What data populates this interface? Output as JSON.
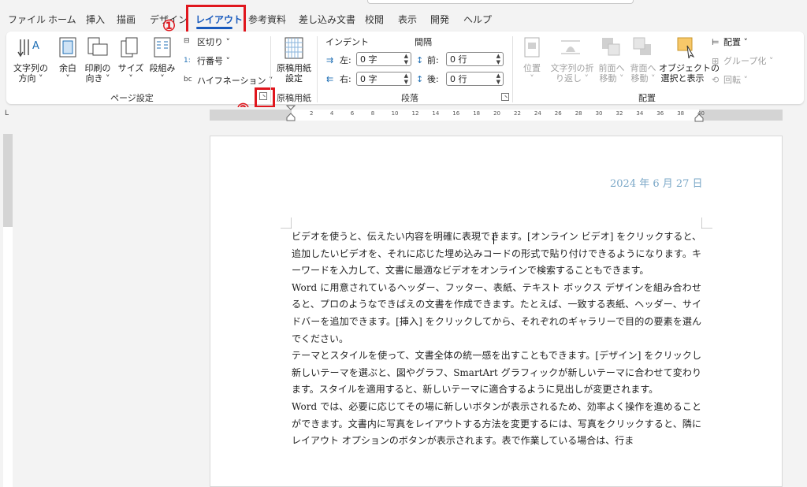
{
  "tabs": [
    "ファイル",
    "ホーム",
    "挿入",
    "描画",
    "デザイン",
    "レイアウト",
    "参考資料",
    "差し込み文書",
    "校閲",
    "表示",
    "開発",
    "ヘルプ"
  ],
  "active_tab": "レイアウト",
  "annotations": {
    "one": "①",
    "two": "②"
  },
  "page_setup": {
    "text_direction": [
      "文字列の",
      "方向 ˅"
    ],
    "margins": [
      "余白",
      "˅"
    ],
    "orientation": [
      "印刷の",
      "向き ˅"
    ],
    "size": [
      "サイズ",
      "˅"
    ],
    "columns": [
      "段組み",
      "˅"
    ],
    "breaks": "区切り ˅",
    "line_numbers": "行番号 ˅",
    "hyphenation": "ハイフネーション ˅",
    "group_label": "ページ設定"
  },
  "genko": {
    "button": [
      "原稿用紙",
      "設定"
    ],
    "group_label": "原稿用紙"
  },
  "paragraph": {
    "indent_header": "インデント",
    "spacing_header": "間隔",
    "left_label": "左:",
    "right_label": "右:",
    "before_label": "前:",
    "after_label": "後:",
    "left_value": "0 字",
    "right_value": "0 字",
    "before_value": "0 行",
    "after_value": "0 行",
    "group_label": "段落"
  },
  "arrange": {
    "position": [
      "位置",
      "˅"
    ],
    "wrap": [
      "文字列の折",
      "り返し ˅"
    ],
    "forward": [
      "前面へ",
      "移動 ˅"
    ],
    "backward": [
      "背面へ",
      "移動 ˅"
    ],
    "selection": [
      "オブジェクトの",
      "選択と表示"
    ],
    "align": "配置 ˅",
    "group": "グループ化 ˅",
    "rotate": "回転 ˅",
    "group_label": "配置"
  },
  "ruler_numbers": [
    "2",
    "4",
    "6",
    "8",
    "10",
    "12",
    "14",
    "16",
    "18",
    "20",
    "22",
    "24",
    "26",
    "28",
    "30",
    "32",
    "34",
    "36",
    "38",
    "40"
  ],
  "document": {
    "date": "2024 年 6 月 27 日",
    "paragraphs": [
      "ビデオを使うと、伝えたい内容を明確に表現できます。[オンライン ビデオ] をクリックすると、追加したいビデオを、それに応じた埋め込みコードの形式で貼り付けできるようになります。キーワードを入力して、文書に最適なビデオをオンラインで検索することもできます。",
      "Word に用意されているヘッダー、フッター、表紙、テキスト ボックス デザインを組み合わせると、プロのようなできばえの文書を作成できます。たとえば、一致する表紙、ヘッダー、サイドバーを追加できます。[挿入] をクリックしてから、それぞれのギャラリーで目的の要素を選んでください。",
      "テーマとスタイルを使って、文書全体の統一感を出すこともできます。[デザイン] をクリックし新しいテーマを選ぶと、図やグラフ、SmartArt グラフィックが新しいテーマに合わせて変わります。スタイルを適用すると、新しいテーマに適合するように見出しが変更されます。",
      "Word では、必要に応じてその場に新しいボタンが表示されるため、効率よく操作を進めることができます。文書内に写真をレイアウトする方法を変更するには、写真をクリックすると、隣にレイアウト オプションのボタンが表示されます。表で作業している場合は、行ま"
    ]
  }
}
